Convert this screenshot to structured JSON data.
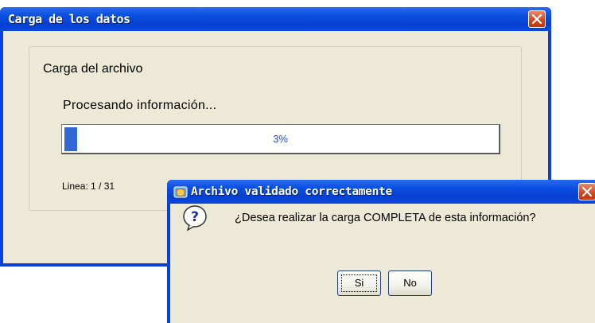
{
  "main_window": {
    "title": "Carga de los datos",
    "group_title": "Carga del archivo",
    "status_text": "Procesando información...",
    "progress": {
      "percent_label": "3%",
      "fraction": 0.03
    },
    "line_info": "Linea: 1 / 31"
  },
  "dialog": {
    "title": "Archivo validado correctamente",
    "question_icon": "question-icon",
    "message": "¿Desea realizar la carga COMPLETA de esta información?",
    "buttons": {
      "yes": "Si",
      "no": "No"
    }
  },
  "colors": {
    "titlebar_blue": "#0a4fe0",
    "client_bg": "#ece9d8",
    "progress_fill": "#3168d8",
    "close_red": "#d2461c"
  }
}
